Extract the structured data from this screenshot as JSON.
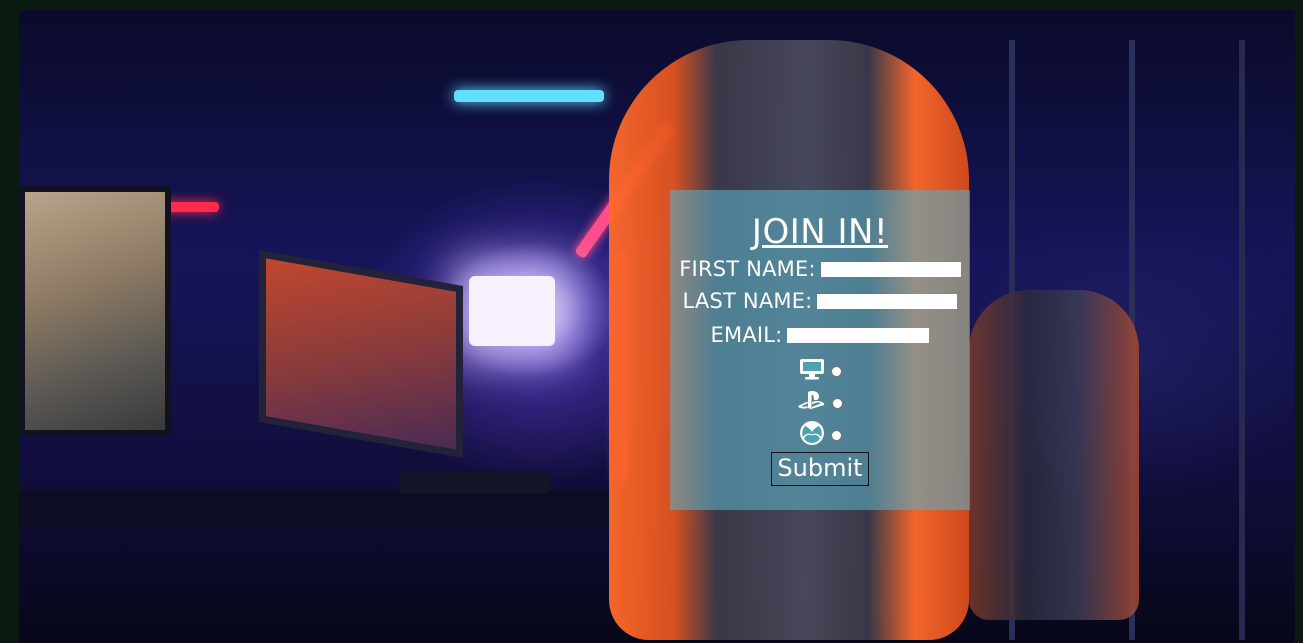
{
  "form": {
    "title": "JOIN IN!",
    "first_name_label": "FIRST NAME:",
    "first_name_value": "",
    "last_name_label": "LAST NAME:",
    "last_name_value": "",
    "email_label": "EMAIL:",
    "email_value": "",
    "platforms": [
      {
        "icon": "desktop-icon"
      },
      {
        "icon": "playstation-icon"
      },
      {
        "icon": "xbox-icon"
      }
    ],
    "submit_label": "Submit"
  },
  "colors": {
    "panel": "#5aaabe",
    "page_background": "#0b1a10"
  }
}
